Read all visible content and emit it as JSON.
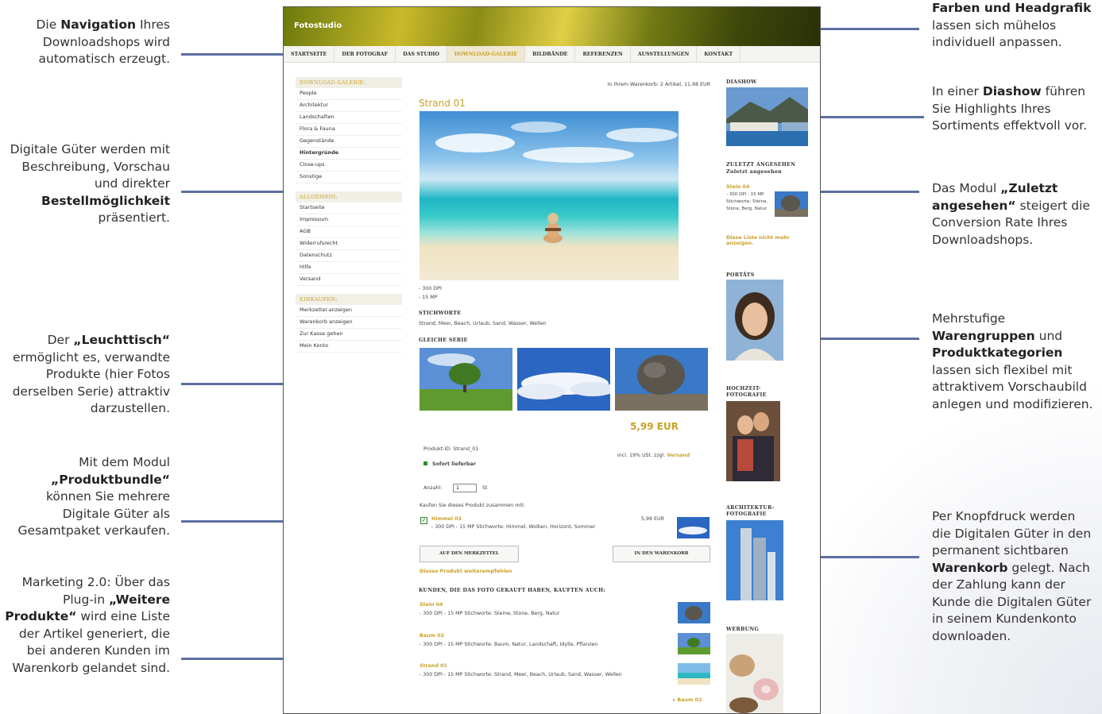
{
  "annotations": {
    "navigation": {
      "pre": "Die ",
      "bold1": "Navigation",
      "post": " Ihres Downloadshops wird automatisch erzeugt."
    },
    "digital_goods": {
      "pre": "Digitale Güter werden mit Beschreibung, Vorschau und direkter ",
      "bold1": "Bestellmöglichkeit",
      "post": " präsentiert."
    },
    "lighttable": {
      "pre": "Der ",
      "bold1": "„Leuchttisch“",
      "post": " ermöglicht es, verwandte Produkte (hier Fotos derselben Serie) attraktiv darzustellen."
    },
    "bundle": {
      "pre": "Mit dem Modul ",
      "bold1": "„Produktbundle“",
      "post": " können Sie mehrere Digitale Güter als Gesamtpaket verkaufen."
    },
    "marketing": {
      "pre": "Marketing 2.0: Über das Plug-in ",
      "bold1": "„Weitere Produkte“",
      "post": " wird eine Liste der Artikel generiert, die bei anderen Kunden im Warenkorb gelandet sind."
    },
    "colors": {
      "bold1": "Farben und Headgrafik",
      "post": " lassen sich mühelos individuell anpassen."
    },
    "diashow": {
      "pre": "In einer ",
      "bold1": "Diashow",
      "post": " führen Sie Highlights Ihres Sortiments effektvoll vor."
    },
    "recent": {
      "pre": "Das Modul ",
      "bold1": "„Zuletzt angesehen“",
      "post": " steigert die Conversion Rate Ihres Downloadshops."
    },
    "groups": {
      "pre": "Mehrstufige ",
      "bold1": "Warengruppen",
      "mid": " und ",
      "bold2": "Produktkategorien",
      "post": " lassen sich flexibel mit attraktivem Vorschaubild anlegen und modifizieren."
    },
    "cart": {
      "pre": "Per Knopfdruck werden die Digitalen Güter in den permanent sichtbaren ",
      "bold1": "Warenkorb",
      "post": " gelegt. Nach der Zahlung kann der Kunde die Digitalen Güter in seinem Kundenkonto downloaden."
    }
  },
  "shop": {
    "logo": "Fotostudio",
    "nav": [
      "STARTSEITE",
      "DER FOTOGRAF",
      "DAS STUDIO",
      "DOWNLOAD-GALERIE",
      "BILDBÄNDE",
      "REFERENZEN",
      "AUSSTELLUNGEN",
      "KONTAKT"
    ],
    "nav_active_index": 3,
    "sidebar": {
      "gallery_head": "DOWNLOAD-GALERIE:",
      "gallery_items": [
        "People",
        "Architektur",
        "Landschaften",
        "Flora & Fauna",
        "Gegenstände",
        "Hintergründe",
        "Close-ups",
        "Sonstige"
      ],
      "general_head": "ALLGEMEIN:",
      "general_items": [
        "Startseite",
        "Impressum",
        "AGB",
        "Widerrufsrecht",
        "Datenschutz",
        "Hilfe",
        "Versand"
      ],
      "shop_head": "EINKAUFEN:",
      "shop_items": [
        "Merkzettel anzeigen",
        "Warenkorb anzeigen",
        "Zur Kasse gehen",
        "Mein Konto"
      ]
    },
    "cart_status": "In Ihrem Warenkorb: 2 Artikel, 11,98 EUR",
    "product": {
      "title": "Strand 01",
      "dpi": "- 300 DPI",
      "mp": "- 15 MP",
      "keywords_head": "STICHWORTE",
      "keywords": "Strand, Meer, Beach, Urlaub, Sand, Wasser, Wellen",
      "series_head": "GLEICHE SERIE",
      "price": "5,99 EUR",
      "product_id": "Produkt-ID: Strand_01",
      "vat": "incl. 19% USt. zzgl. ",
      "shipping": "Versand",
      "availability": "Sofort lieferbar",
      "qty_label": "Anzahl:",
      "qty_value": "1",
      "qty_unit": "St",
      "bundle_label": "Kaufen Sie dieses Produkt zusammen mit:",
      "bundle_name": "Himmel 03",
      "bundle_desc": "- 300 DPI - 15 MP Stichworte: Himmel, Wolken, Horizont, Sommer",
      "bundle_price": "5,99 EUR",
      "btn_notepad": "AUF DEN MERKZETTEL",
      "btn_cart": "IN DEN WARENKORB",
      "recommend": "Dieses Produkt weiterempfehlen",
      "others_head": "KUNDEN, DIE DAS FOTO GEKAUFT HABEN, KAUFTEN AUCH:",
      "others": [
        {
          "name": "Stein 04",
          "desc": "- 300 DPI - 15 MP Stichworte: Steine, Stone, Berg, Natur"
        },
        {
          "name": "Baum 02",
          "desc": "- 300 DPI - 15 MP Stichworte: Baum, Natur, Landschaft, Idylle, Pflanzen"
        },
        {
          "name": "Strand 01",
          "desc": "- 300 DPI - 15 MP Stichworte: Strand, Meer, Beach, Urlaub, Sand, Wasser, Wellen"
        }
      ],
      "next_link": "▸ Baum 02"
    },
    "right": {
      "diashow": "DIASHOW",
      "recent_head": "ZULETZT ANGESEHEN",
      "recent_sub": "Zuletzt angesehen",
      "recent_name": "Stein 04",
      "recent_desc": "- 300 DPI - 15 MP Stichworte: Steine, Stone, Berg, Natur",
      "recent_hide": "Diese Liste nicht mehr anzeigen.",
      "portraits": "PORTÄTS",
      "wedding": "HOCHZEIT-\nFOTOGRAFIE",
      "architecture": "ARCHITEKTUR-\nFOTOGRAFIE",
      "ads": "WERBUNG"
    }
  },
  "colors": {
    "accent": "#c9a22a",
    "connector": "#5c6fa0",
    "in_stock": "#2a8a2a"
  }
}
